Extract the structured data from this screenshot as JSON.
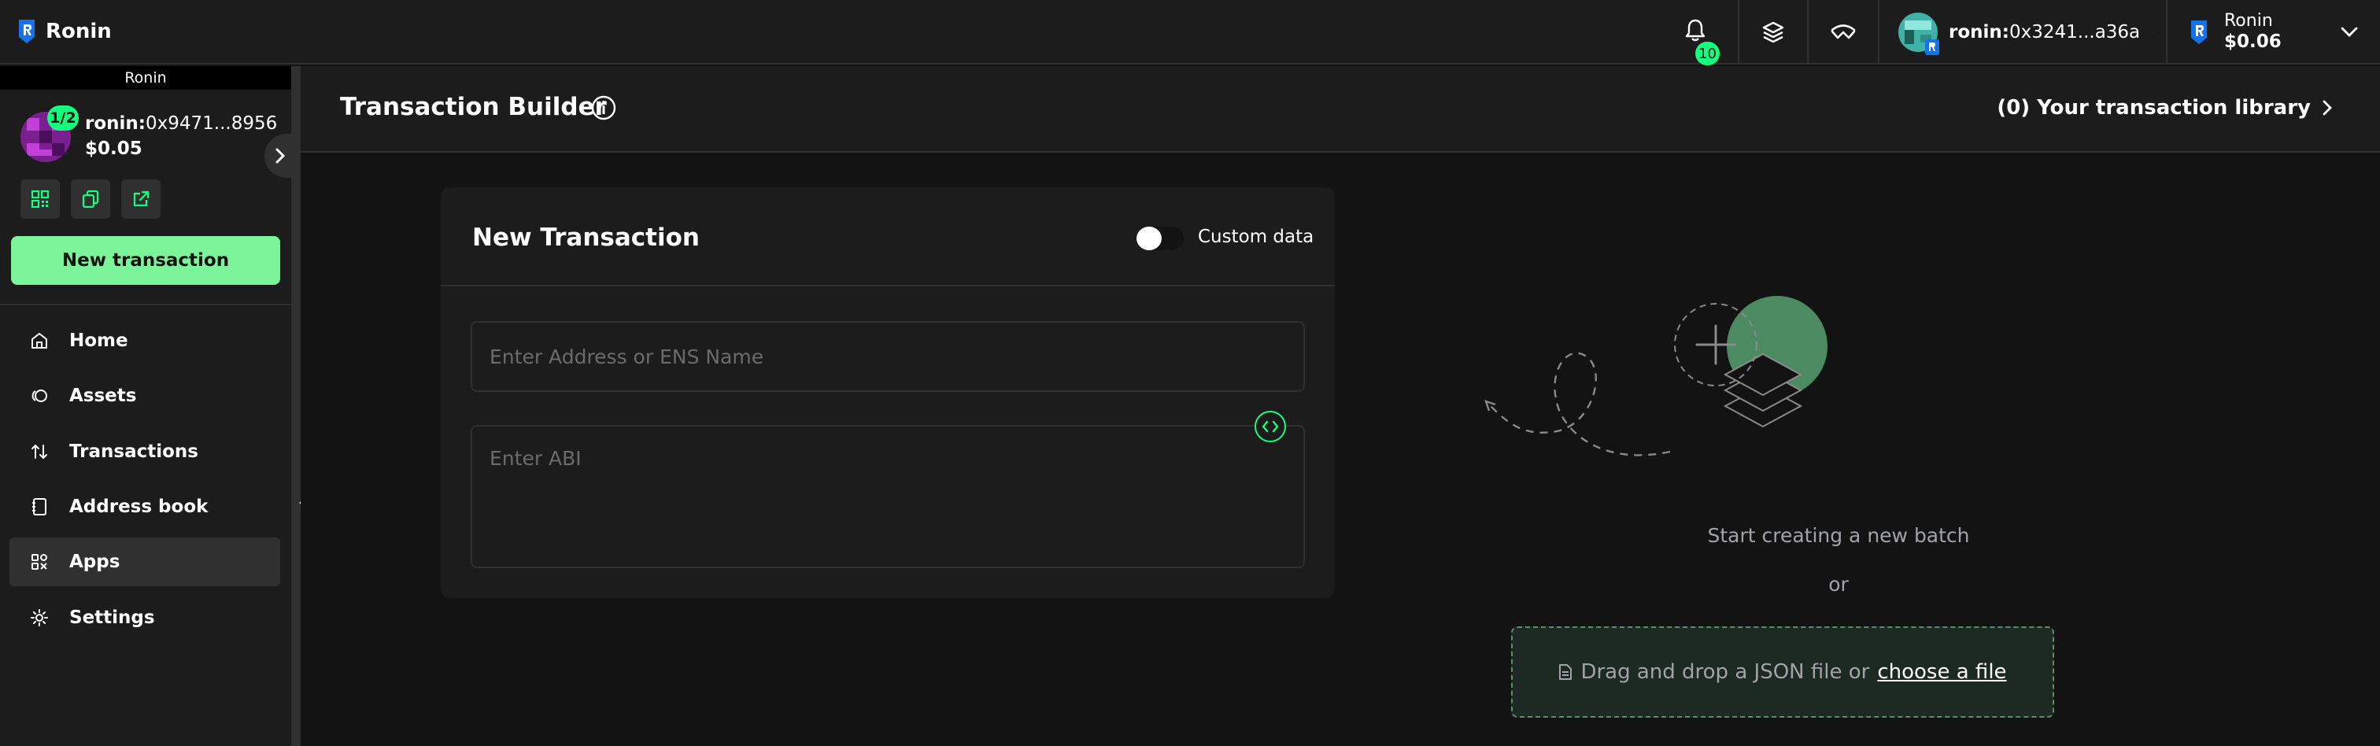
{
  "header": {
    "brand": "Ronin",
    "notifications_count": "10",
    "account_prefix": "ronin:",
    "account_address": "0x3241...a36a",
    "chain_name": "Ronin",
    "chain_balance": "$0.06"
  },
  "sidebar": {
    "safe_label": "Ronin",
    "threshold": "1/2",
    "address_prefix": "ronin:",
    "address": "0x9471...8956",
    "balance": "$0.05",
    "new_transaction_label": "New transaction",
    "nav": [
      {
        "label": "Home",
        "icon": "home-icon"
      },
      {
        "label": "Assets",
        "icon": "assets-icon"
      },
      {
        "label": "Transactions",
        "icon": "transactions-icon"
      },
      {
        "label": "Address book",
        "icon": "address-book-icon"
      },
      {
        "label": "Apps",
        "icon": "apps-icon",
        "active": true
      },
      {
        "label": "Settings",
        "icon": "settings-icon"
      }
    ]
  },
  "main": {
    "title": "Transaction Builder",
    "library_link": "(0) Your transaction library",
    "card": {
      "title": "New Transaction",
      "custom_data_label": "Custom data",
      "custom_data_enabled": false,
      "address_placeholder": "Enter Address or ENS Name",
      "abi_placeholder": "Enter ABI"
    },
    "empty_state": {
      "text": "Start creating a new batch",
      "or": "or",
      "drop_text": "Drag and drop a JSON file or",
      "choose_file": "choose a file"
    }
  },
  "colors": {
    "accent": "#12ff80",
    "button": "#7cf59a",
    "background": "#121312",
    "panel": "#1c1c1c",
    "border": "#303030"
  }
}
